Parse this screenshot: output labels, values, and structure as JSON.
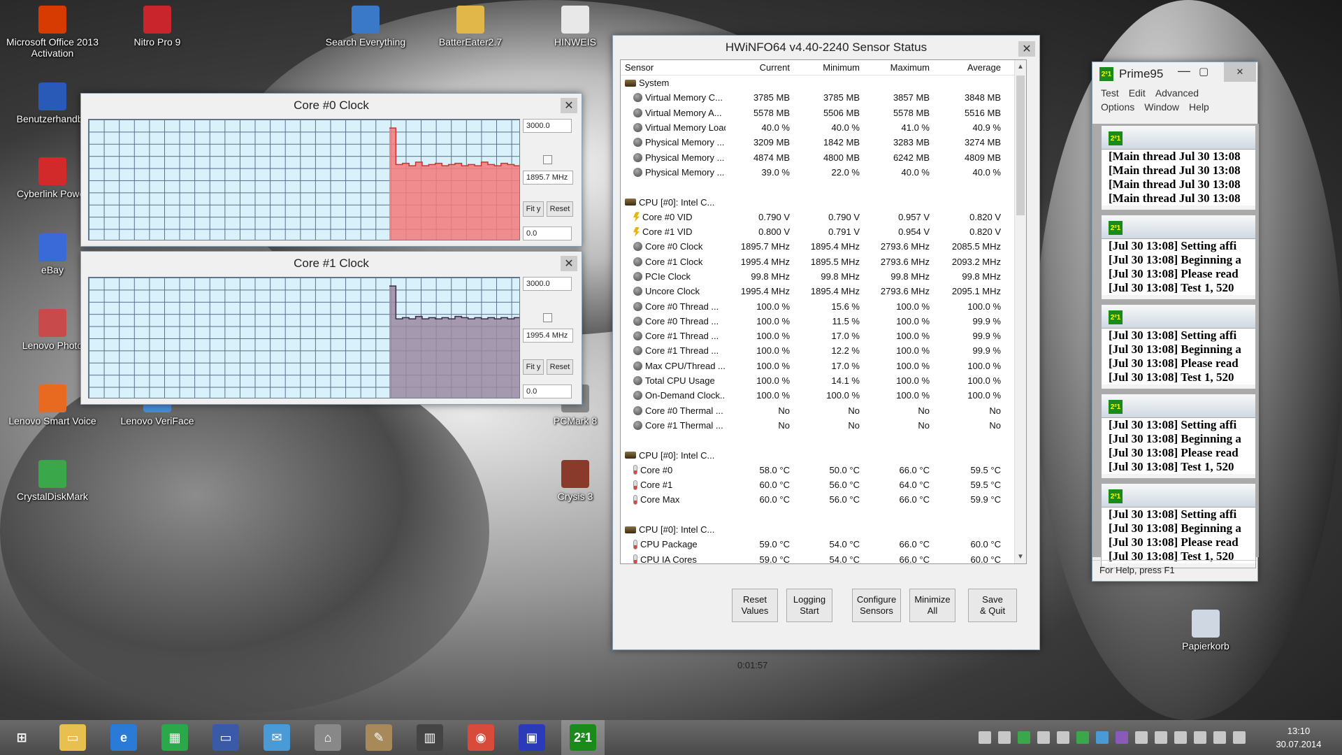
{
  "desktop": {
    "icons": [
      {
        "label": "Microsoft Office 2013\nActivation",
        "icon": "office-icon",
        "color": "#d83b01"
      },
      {
        "label": "Nitro Pro 9",
        "icon": "nitro-icon",
        "color": "#c8262c"
      },
      {
        "label": "Search Everything",
        "icon": "search-everything-icon",
        "color": "#3a78c8"
      },
      {
        "label": "BatterEater2.7",
        "icon": "folder-icon",
        "color": "#e2b74a"
      },
      {
        "label": "HINWEIS",
        "icon": "document-icon",
        "color": "#e8e8e8"
      },
      {
        "label": "Benutzerhandbu",
        "icon": "lenovo-manual-icon",
        "color": "#2a5ab8"
      },
      {
        "label": "Cyberlink Power",
        "icon": "cyberlink-icon",
        "color": "#d22a2a"
      },
      {
        "label": "eBay",
        "icon": "ebay-icon",
        "color": "#3a6ad8"
      },
      {
        "label": "Lenovo Photo",
        "icon": "lenovo-photo-icon",
        "color": "#c84a4a"
      },
      {
        "label": "Lenovo Smart Voice",
        "icon": "smart-voice-icon",
        "color": "#e86a20"
      },
      {
        "label": "Lenovo VeriFace",
        "icon": "veriface-icon",
        "color": "#4a8ad8"
      },
      {
        "label": "PCMark 8",
        "icon": "pcmark-icon",
        "color": "#888"
      },
      {
        "label": "CrystalDiskMark",
        "icon": "crystaldiskmark-icon",
        "color": "#3aa84a"
      },
      {
        "label": "Crysis 3",
        "icon": "crysis-icon",
        "color": "#8a3a2a"
      },
      {
        "label": "Papierkorb",
        "icon": "recycle-bin-icon",
        "color": "#cfd8e2"
      }
    ]
  },
  "graph0": {
    "title": "Core #0 Clock",
    "max_value": "3000.0",
    "current_value": "1895.7 MHz",
    "min_value": "0.0",
    "fit_label": "Fit y",
    "reset_label": "Reset",
    "fill_color": "#f47a7a",
    "line_color": "#d03030",
    "levels": [
      0.93,
      0.63,
      0.64,
      0.62,
      0.65,
      0.62,
      0.63,
      0.64,
      0.62,
      0.63,
      0.64,
      0.62,
      0.63,
      0.62,
      0.65,
      0.63,
      0.62,
      0.64,
      0.63,
      0.62
    ]
  },
  "graph1": {
    "title": "Core #1 Clock",
    "max_value": "3000.0",
    "current_value": "1995.4 MHz",
    "min_value": "0.0",
    "fit_label": "Fit y",
    "reset_label": "Reset",
    "fill_color": "#9a8aa0",
    "line_color": "#3a2a4a",
    "levels": [
      0.93,
      0.66,
      0.67,
      0.66,
      0.68,
      0.66,
      0.67,
      0.66,
      0.67,
      0.66,
      0.68,
      0.67,
      0.66,
      0.67,
      0.66,
      0.67,
      0.66,
      0.67,
      0.66,
      0.67
    ]
  },
  "hwinfo": {
    "title": "HWiNFO64 v4.40-2240 Sensor Status",
    "columns": [
      "Sensor",
      "Current",
      "Minimum",
      "Maximum",
      "Average"
    ],
    "rows": [
      {
        "type": "group",
        "icon": "system",
        "name": "System"
      },
      {
        "icon": "grey",
        "name": "Virtual Memory C...",
        "cur": "3785 MB",
        "min": "3785 MB",
        "max": "3857 MB",
        "avg": "3848 MB"
      },
      {
        "icon": "grey",
        "name": "Virtual Memory A...",
        "cur": "5578 MB",
        "min": "5506 MB",
        "max": "5578 MB",
        "avg": "5516 MB"
      },
      {
        "icon": "grey",
        "name": "Virtual Memory Load",
        "cur": "40.0 %",
        "min": "40.0 %",
        "max": "41.0 %",
        "avg": "40.9 %"
      },
      {
        "icon": "grey",
        "name": "Physical Memory ...",
        "cur": "3209 MB",
        "min": "1842 MB",
        "max": "3283 MB",
        "avg": "3274 MB"
      },
      {
        "icon": "grey",
        "name": "Physical Memory ...",
        "cur": "4874 MB",
        "min": "4800 MB",
        "max": "6242 MB",
        "avg": "4809 MB"
      },
      {
        "icon": "grey",
        "name": "Physical Memory ...",
        "cur": "39.0 %",
        "min": "22.0 %",
        "max": "40.0 %",
        "avg": "40.0 %"
      },
      {
        "type": "blank"
      },
      {
        "type": "group",
        "icon": "chip",
        "name": "CPU [#0]: Intel C..."
      },
      {
        "icon": "volt",
        "name": "Core #0 VID",
        "cur": "0.790 V",
        "min": "0.790 V",
        "max": "0.957 V",
        "avg": "0.820 V"
      },
      {
        "icon": "volt",
        "name": "Core #1 VID",
        "cur": "0.800 V",
        "min": "0.791 V",
        "max": "0.954 V",
        "avg": "0.820 V"
      },
      {
        "icon": "grey",
        "name": "Core #0 Clock",
        "cur": "1895.7 MHz",
        "min": "1895.4 MHz",
        "max": "2793.6 MHz",
        "avg": "2085.5 MHz"
      },
      {
        "icon": "grey",
        "name": "Core #1 Clock",
        "cur": "1995.4 MHz",
        "min": "1895.5 MHz",
        "max": "2793.6 MHz",
        "avg": "2093.2 MHz"
      },
      {
        "icon": "grey",
        "name": "PCIe Clock",
        "cur": "99.8 MHz",
        "min": "99.8 MHz",
        "max": "99.8 MHz",
        "avg": "99.8 MHz"
      },
      {
        "icon": "grey",
        "name": "Uncore Clock",
        "cur": "1995.4 MHz",
        "min": "1895.4 MHz",
        "max": "2793.6 MHz",
        "avg": "2095.1 MHz"
      },
      {
        "icon": "grey",
        "name": "Core #0 Thread ...",
        "cur": "100.0 %",
        "min": "15.6 %",
        "max": "100.0 %",
        "avg": "100.0 %"
      },
      {
        "icon": "grey",
        "name": "Core #0 Thread ...",
        "cur": "100.0 %",
        "min": "11.5 %",
        "max": "100.0 %",
        "avg": "99.9 %"
      },
      {
        "icon": "grey",
        "name": "Core #1 Thread ...",
        "cur": "100.0 %",
        "min": "17.0 %",
        "max": "100.0 %",
        "avg": "99.9 %"
      },
      {
        "icon": "grey",
        "name": "Core #1 Thread ...",
        "cur": "100.0 %",
        "min": "12.2 %",
        "max": "100.0 %",
        "avg": "99.9 %"
      },
      {
        "icon": "grey",
        "name": "Max CPU/Thread ...",
        "cur": "100.0 %",
        "min": "17.0 %",
        "max": "100.0 %",
        "avg": "100.0 %"
      },
      {
        "icon": "grey",
        "name": "Total CPU Usage",
        "cur": "100.0 %",
        "min": "14.1 %",
        "max": "100.0 %",
        "avg": "100.0 %"
      },
      {
        "icon": "grey",
        "name": "On-Demand Clock...",
        "cur": "100.0 %",
        "min": "100.0 %",
        "max": "100.0 %",
        "avg": "100.0 %"
      },
      {
        "icon": "grey",
        "name": "Core #0 Thermal ...",
        "cur": "No",
        "min": "No",
        "max": "No",
        "avg": "No"
      },
      {
        "icon": "grey",
        "name": "Core #1 Thermal ...",
        "cur": "No",
        "min": "No",
        "max": "No",
        "avg": "No"
      },
      {
        "type": "blank"
      },
      {
        "type": "group",
        "icon": "chip",
        "name": "CPU [#0]: Intel C..."
      },
      {
        "icon": "therm",
        "name": "Core #0",
        "cur": "58.0 °C",
        "min": "50.0 °C",
        "max": "66.0 °C",
        "avg": "59.5 °C"
      },
      {
        "icon": "therm",
        "name": "Core #1",
        "cur": "60.0 °C",
        "min": "56.0 °C",
        "max": "64.0 °C",
        "avg": "59.5 °C"
      },
      {
        "icon": "therm",
        "name": "Core Max",
        "cur": "60.0 °C",
        "min": "56.0 °C",
        "max": "66.0 °C",
        "avg": "59.9 °C"
      },
      {
        "type": "blank"
      },
      {
        "type": "group",
        "icon": "chip",
        "name": "CPU [#0]: Intel C..."
      },
      {
        "icon": "therm",
        "name": "CPU Package",
        "cur": "59.0 °C",
        "min": "54.0 °C",
        "max": "66.0 °C",
        "avg": "60.0 °C"
      },
      {
        "icon": "therm",
        "name": "CPU IA Cores",
        "cur": "59.0 °C",
        "min": "54.0 °C",
        "max": "66.0 °C",
        "avg": "60.0 °C"
      }
    ],
    "buttons": [
      {
        "id": "reset-values",
        "label": "Reset\nValues"
      },
      {
        "id": "logging-start",
        "label": "Logging\nStart"
      },
      {
        "id": "configure-sensors",
        "label": "Configure\nSensors"
      },
      {
        "id": "minimize-all",
        "label": "Minimize\nAll"
      },
      {
        "id": "save-quit",
        "label": "Save\n& Quit"
      }
    ],
    "elapsed": "0:01:57"
  },
  "prime95": {
    "title": "Prime95",
    "menu_row1": [
      "Test",
      "Edit",
      "Advanced"
    ],
    "menu_row2": [
      "Options",
      "Window",
      "Help"
    ],
    "panes": [
      {
        "lines": [
          "[Main thread Jul 30 13:08",
          "[Main thread Jul 30 13:08",
          "[Main thread Jul 30 13:08",
          "[Main thread Jul 30 13:08"
        ]
      },
      {
        "lines": [
          "[Jul 30 13:08] Setting affi",
          "[Jul 30 13:08] Beginning a",
          "[Jul 30 13:08] Please read",
          "[Jul 30 13:08] Test 1, 520"
        ]
      },
      {
        "lines": [
          "[Jul 30 13:08] Setting affi",
          "[Jul 30 13:08] Beginning a",
          "[Jul 30 13:08] Please read",
          "[Jul 30 13:08] Test 1, 520"
        ]
      },
      {
        "lines": [
          "[Jul 30 13:08] Setting affi",
          "[Jul 30 13:08] Beginning a",
          "[Jul 30 13:08] Please read",
          "[Jul 30 13:08] Test 1, 520"
        ]
      },
      {
        "lines": [
          "[Jul 30 13:08] Setting affi",
          "[Jul 30 13:08] Beginning a",
          "[Jul 30 13:08] Please read",
          "[Jul 30 13:08] Test 1, 520"
        ]
      }
    ],
    "status": "For Help, press F1",
    "icon_text": "2²1"
  },
  "taskbar": {
    "apps": [
      {
        "name": "start-button",
        "color": "transparent",
        "glyph": "⊞"
      },
      {
        "name": "file-explorer-icon",
        "color": "#e8c050",
        "glyph": "▭"
      },
      {
        "name": "internet-explorer-icon",
        "color": "#2a7ad8",
        "glyph": "e"
      },
      {
        "name": "store-icon",
        "color": "#2aa84a",
        "glyph": "▦"
      },
      {
        "name": "lenovo-monitor-icon",
        "color": "#3a5aa8",
        "glyph": "▭"
      },
      {
        "name": "mail-icon",
        "color": "#4a9ad8",
        "glyph": "✉"
      },
      {
        "name": "home-icon",
        "color": "#888",
        "glyph": "⌂"
      },
      {
        "name": "paint-icon",
        "color": "#a88a5a",
        "glyph": "✎"
      },
      {
        "name": "hwinfo-taskbar-icon",
        "color": "#444",
        "glyph": "▥"
      },
      {
        "name": "chrome-icon",
        "color": "#d84a3a",
        "glyph": "◉"
      },
      {
        "name": "save-disk-icon",
        "color": "#2a3ab8",
        "glyph": "▣"
      },
      {
        "name": "prime95-taskbar-icon",
        "color": "#1a8a1a",
        "glyph": "2²1"
      }
    ],
    "time": "13:10",
    "date": "30.07.2014"
  }
}
